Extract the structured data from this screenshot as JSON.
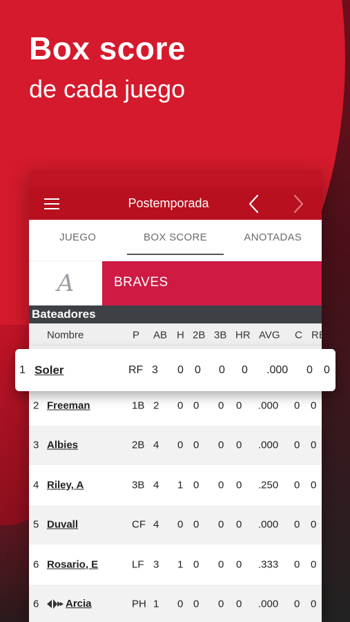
{
  "promo": {
    "headline": "Box score",
    "subheadline": "de cada juego"
  },
  "appbar": {
    "title": "Postemporada",
    "menu_icon": "hamburger-menu-icon",
    "prev_icon": "chevron-left-icon",
    "next_icon": "chevron-right-icon"
  },
  "tabs": [
    {
      "label": "JUEGO",
      "active": false
    },
    {
      "label": "BOX SCORE",
      "active": true
    },
    {
      "label": "ANOTADAS",
      "active": false
    }
  ],
  "team": {
    "logo_letter": "A",
    "name": "BRAVES",
    "color": "#cf1b44"
  },
  "section": {
    "title": "Bateadores"
  },
  "columns": {
    "nombre": "Nombre",
    "p": "P",
    "ab": "AB",
    "h": "H",
    "b2": "2B",
    "b3": "3B",
    "hr": "HR",
    "avg": "AVG",
    "c": "C",
    "rb": "RB"
  },
  "players": [
    {
      "num": "1",
      "name": "Soler",
      "pos": "RF",
      "ab": "3",
      "h": "0",
      "b2": "0",
      "b3": "0",
      "hr": "0",
      "avg": ".000",
      "c": "0",
      "rb": "0"
    },
    {
      "num": "2",
      "name": "Freeman",
      "pos": "1B",
      "ab": "2",
      "h": "0",
      "b2": "0",
      "b3": "0",
      "hr": "0",
      "avg": ".000",
      "c": "0",
      "rb": "0"
    },
    {
      "num": "3",
      "name": "Albies",
      "pos": "2B",
      "ab": "4",
      "h": "0",
      "b2": "0",
      "b3": "0",
      "hr": "0",
      "avg": ".000",
      "c": "0",
      "rb": "0"
    },
    {
      "num": "4",
      "name": "Riley, A",
      "pos": "3B",
      "ab": "4",
      "h": "1",
      "b2": "0",
      "b3": "0",
      "hr": "0",
      "avg": ".250",
      "c": "0",
      "rb": "0"
    },
    {
      "num": "5",
      "name": "Duvall",
      "pos": "CF",
      "ab": "4",
      "h": "0",
      "b2": "0",
      "b3": "0",
      "hr": "0",
      "avg": ".000",
      "c": "0",
      "rb": "0"
    },
    {
      "num": "6",
      "name": "Rosario, E",
      "pos": "LF",
      "ab": "3",
      "h": "1",
      "b2": "0",
      "b3": "0",
      "hr": "0",
      "avg": ".333",
      "c": "0",
      "rb": "0"
    },
    {
      "num": "6",
      "name": "Arcia",
      "pos": "PH",
      "ab": "1",
      "h": "0",
      "b2": "0",
      "b3": "0",
      "hr": "0",
      "avg": ".000",
      "c": "0",
      "rb": "0",
      "icon": "substitution-arrows-icon"
    }
  ]
}
